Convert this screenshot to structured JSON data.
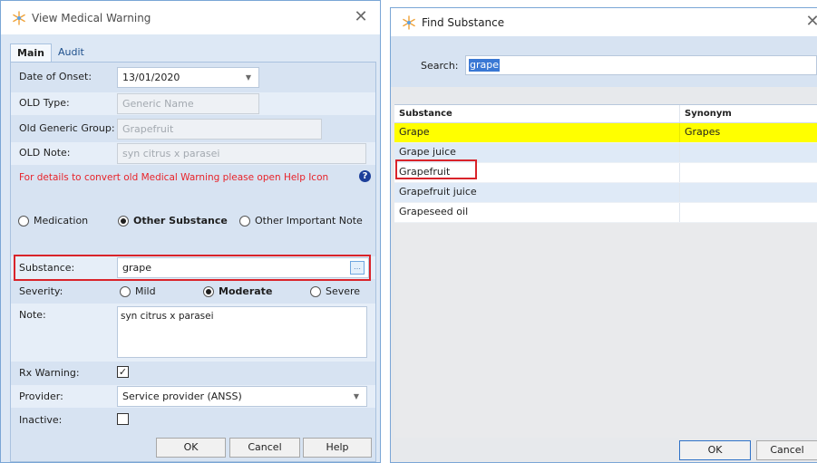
{
  "left_dialog": {
    "title": "View Medical Warning",
    "tabs": [
      {
        "label": "Main",
        "active": true
      },
      {
        "label": "Audit",
        "active": false
      }
    ],
    "fields": {
      "date_of_onset": {
        "label": "Date of Onset:",
        "value": "13/01/2020"
      },
      "old_type": {
        "label": "OLD Type:",
        "value": "Generic Name"
      },
      "old_generic_group": {
        "label": "Old Generic Group:",
        "value": "Grapefruit"
      },
      "old_note": {
        "label": "OLD Note:",
        "value": "syn citrus x parasei"
      }
    },
    "help_notice": "For details to convert old Medical Warning please open Help Icon",
    "warning_type": {
      "options": [
        "Medication",
        "Other Substance",
        "Other Important Note"
      ],
      "selected": "Other Substance"
    },
    "substance": {
      "label": "Substance:",
      "value": "grape"
    },
    "severity": {
      "label": "Severity:",
      "options": [
        "Mild",
        "Moderate",
        "Severe"
      ],
      "selected": "Moderate"
    },
    "note": {
      "label": "Note:",
      "value": "syn citrus x parasei"
    },
    "rx_warning": {
      "label": "Rx Warning:",
      "checked": true
    },
    "provider": {
      "label": "Provider:",
      "value": "Service provider (ANSS)"
    },
    "inactive": {
      "label": "Inactive:",
      "checked": false
    },
    "buttons": {
      "ok": "OK",
      "cancel": "Cancel",
      "help": "Help"
    }
  },
  "right_dialog": {
    "title": "Find Substance",
    "search": {
      "label": "Search:",
      "value": "grape"
    },
    "columns": [
      "Substance",
      "Synonym"
    ],
    "rows": [
      {
        "substance": "Grape",
        "synonym": "Grapes",
        "selected": true
      },
      {
        "substance": "Grape juice",
        "synonym": ""
      },
      {
        "substance": "Grapefruit",
        "synonym": ""
      },
      {
        "substance": "Grapefruit juice",
        "synonym": ""
      },
      {
        "substance": "Grapeseed oil",
        "synonym": ""
      }
    ],
    "buttons": {
      "ok": "OK",
      "cancel": "Cancel"
    }
  },
  "colors": {
    "accent": "#2f72c8",
    "highlight_row": "#ffff00",
    "alert_text": "#e8232a",
    "annotation_border": "#d9232a",
    "help_icon": "#1d3f9a"
  },
  "icons": [
    "app-snowflake-icon",
    "close-icon",
    "help-icon",
    "dropdown-arrow-icon",
    "ellipsis-button-icon",
    "checkmark-icon"
  ]
}
